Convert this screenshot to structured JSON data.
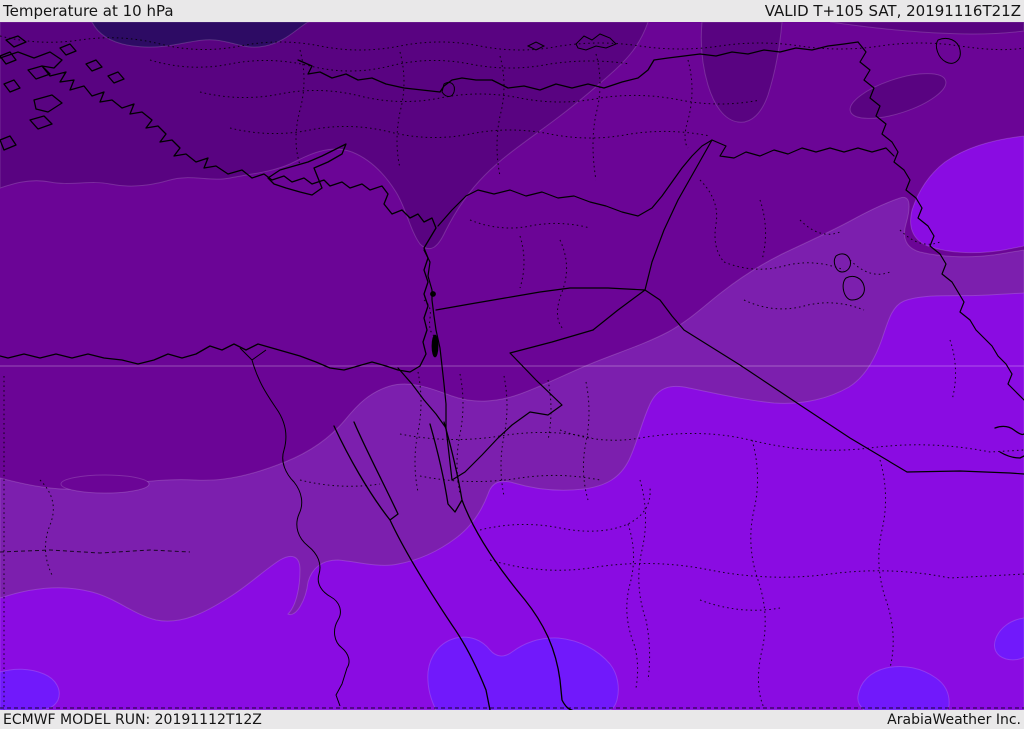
{
  "header": {
    "title": "Temperature at 10 hPa",
    "valid": "VALID T+105 SAT, 20191116T21Z"
  },
  "footer": {
    "model_run": "ECMWF MODEL RUN: 20191112T12Z",
    "credit": "ArabiaWeather Inc."
  },
  "map": {
    "description": "ECMWF 10 hPa temperature forecast shaded in purple bands over the Middle East (Turkey, Cyprus, Levant, Egypt, Iraq, Saudi Arabia)",
    "colors": {
      "band_coldest": "#2d0b64",
      "band_cold": "#590381",
      "band_base": "#6b0596",
      "band_mild": "#7c1fae",
      "band_warm": "#8a0ce2",
      "band_warmest": "#7119fb"
    },
    "bands": [
      {
        "rank": 0,
        "label": "coldest",
        "color": "#2d0b64",
        "location": "far north patches"
      },
      {
        "rank": 1,
        "label": "very cold",
        "color": "#590381",
        "location": "Turkey / Aegean band"
      },
      {
        "rank": 2,
        "label": "cold",
        "color": "#6b0596",
        "location": "Syria, north Egypt, north Iraq"
      },
      {
        "rank": 3,
        "label": "mild",
        "color": "#7c1fae",
        "location": "Jordan, Sinai, central band"
      },
      {
        "rank": 4,
        "label": "warm",
        "color": "#8a0ce2",
        "location": "Saudi Arabia, south"
      },
      {
        "rank": 5,
        "label": "warmest",
        "color": "#7119fb",
        "location": "southern blobs near Red Sea"
      }
    ]
  }
}
